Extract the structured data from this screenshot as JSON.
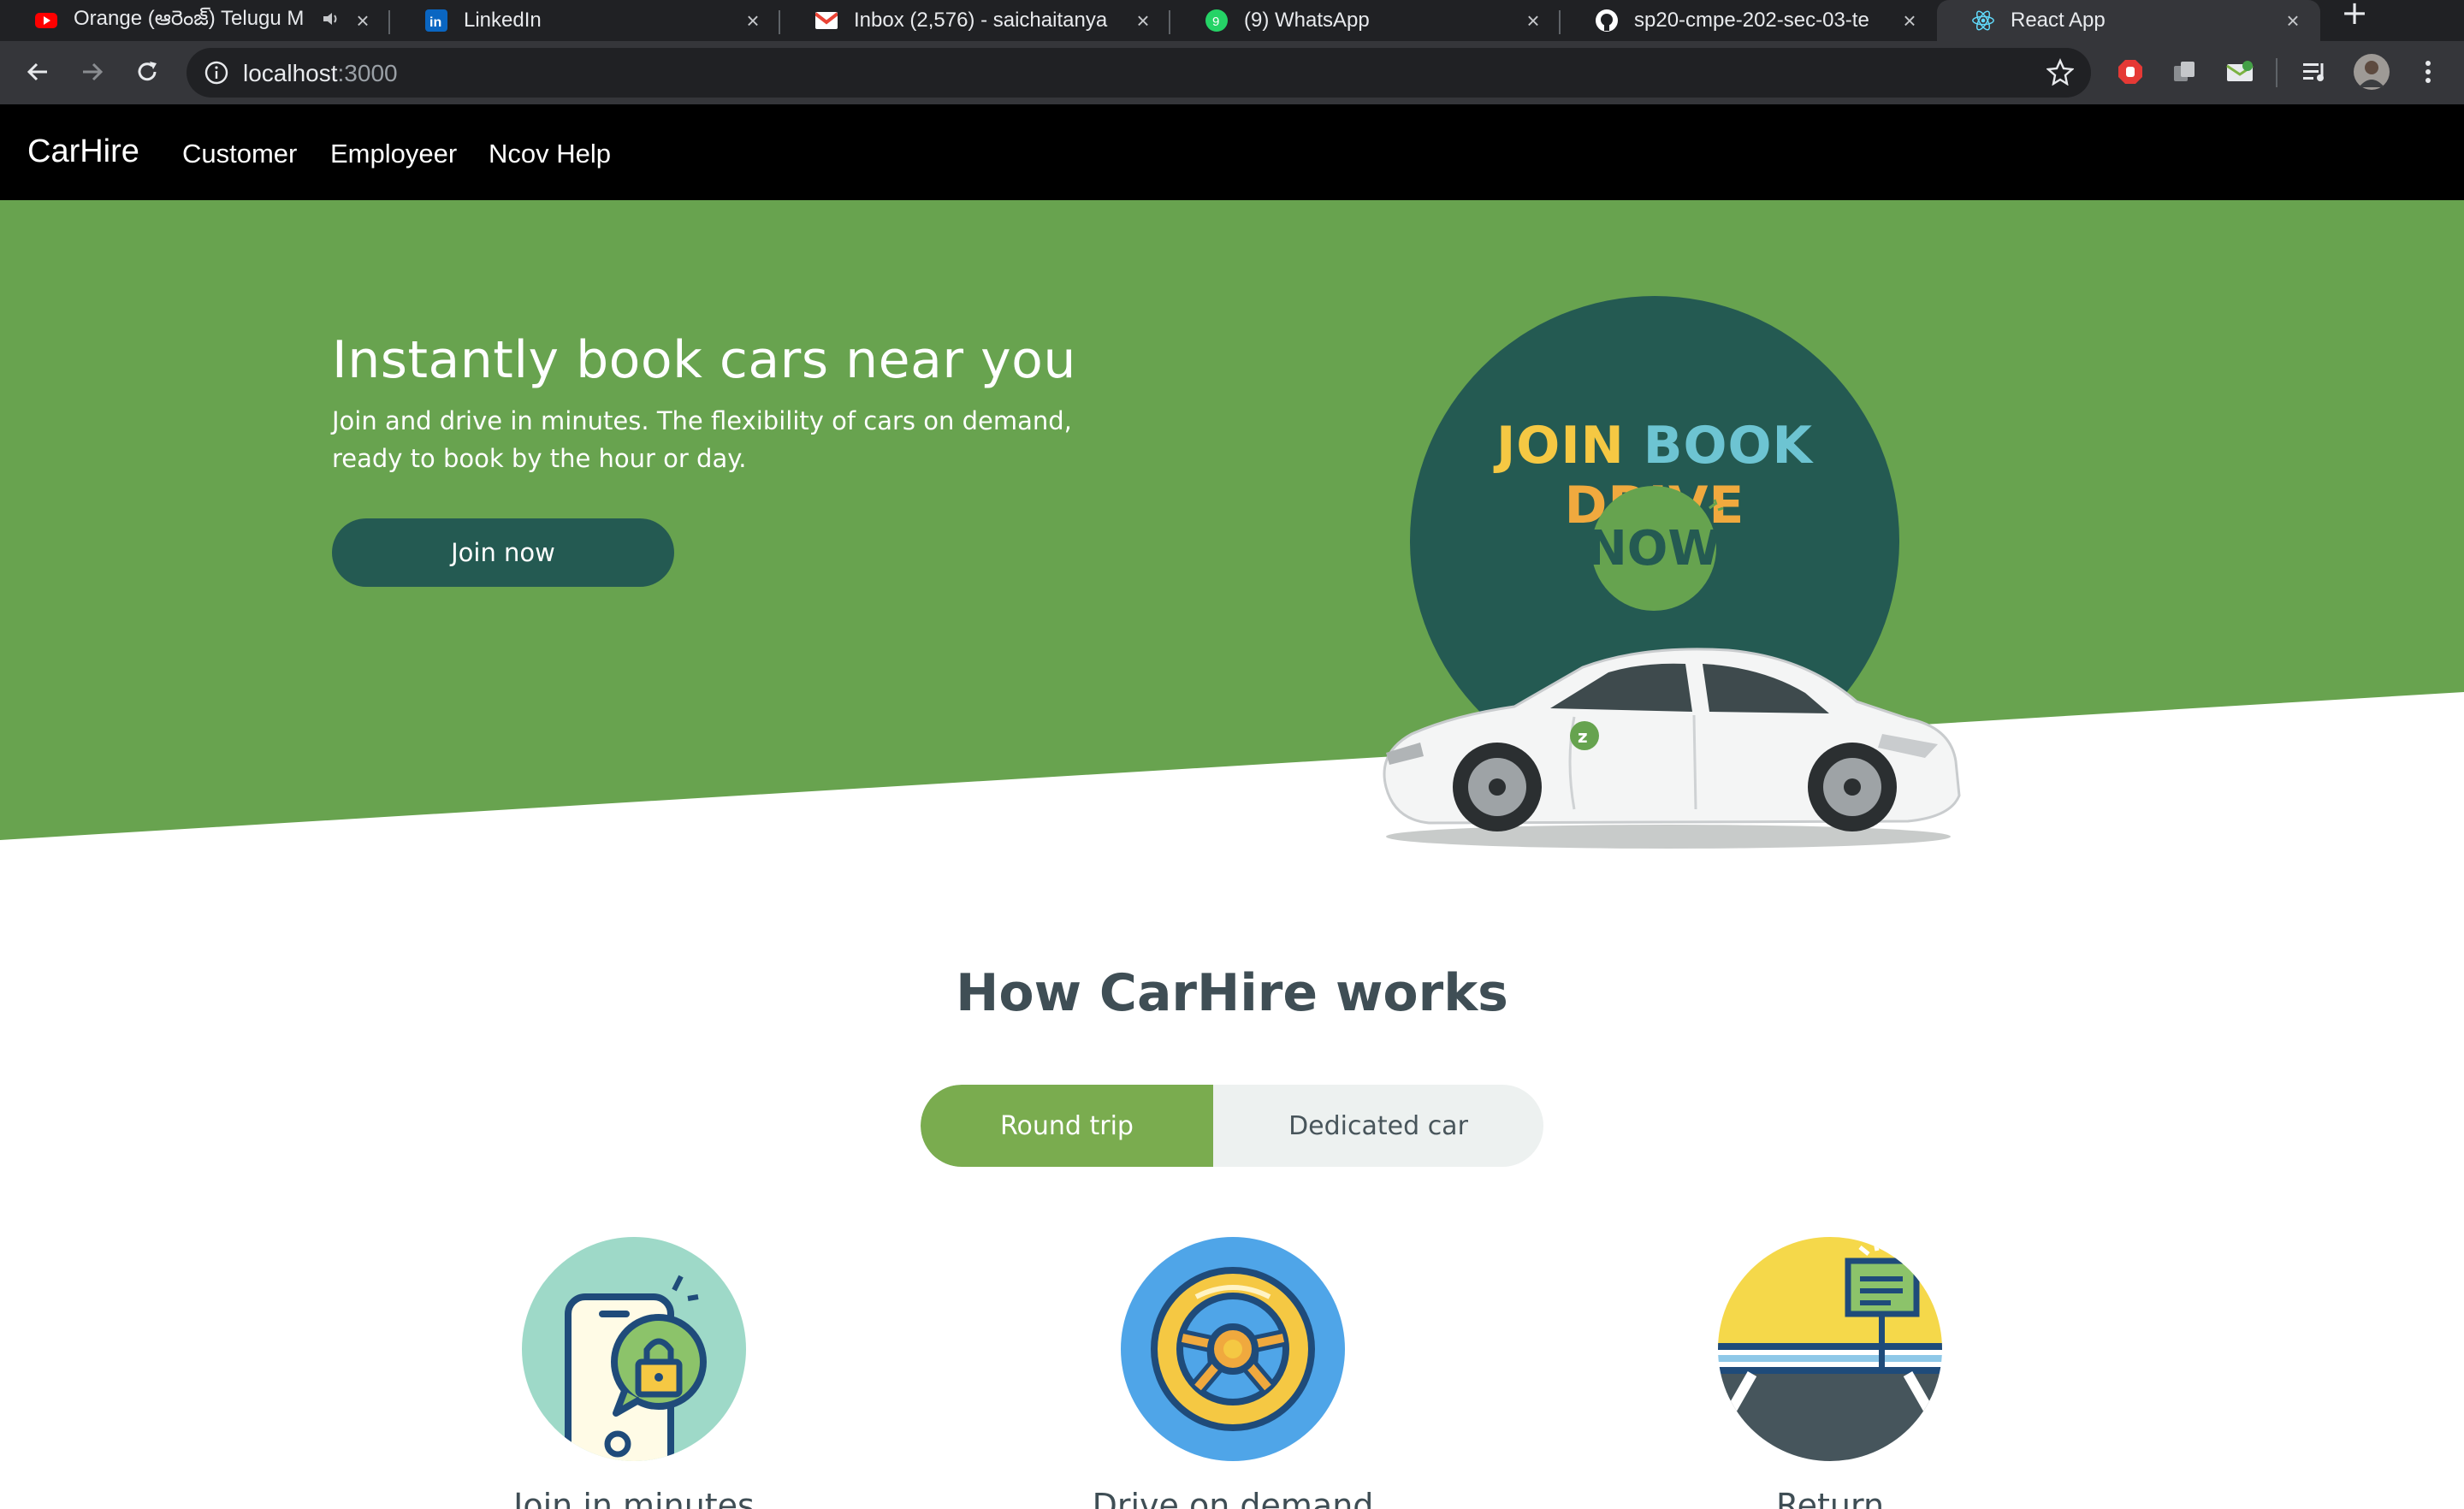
{
  "browser": {
    "tabs": [
      {
        "title": "Orange (ఆరెంజ్) Telugu M",
        "favicon": "youtube-icon",
        "audio": true
      },
      {
        "title": "LinkedIn",
        "favicon": "linkedin-icon"
      },
      {
        "title": "Inbox (2,576) - saichaitanya",
        "favicon": "gmail-icon"
      },
      {
        "title": "(9) WhatsApp",
        "favicon": "whatsapp-icon"
      },
      {
        "title": "sp20-cmpe-202-sec-03-te",
        "favicon": "github-icon"
      },
      {
        "title": "React App",
        "favicon": "react-icon",
        "active": true
      }
    ],
    "url_host": "localhost",
    "url_port": ":3000"
  },
  "nav": {
    "brand": "CarHire",
    "links": [
      "Customer",
      "Employeer",
      "Ncov Help"
    ]
  },
  "hero": {
    "title": "Instantly book cars near you",
    "subtitle_line1": "Join and drive in minutes. The flexibility of cars on demand,",
    "subtitle_line2": "ready to book by the hour or day.",
    "cta": "Join now",
    "promo": {
      "word1": "JOIN",
      "word2": "BOOK",
      "word3": "DRIVE",
      "now": "NOW"
    }
  },
  "how": {
    "title": "How CarHire works",
    "toggle": {
      "active": "Round trip",
      "inactive": "Dedicated car"
    },
    "steps": [
      {
        "label": "Join in minutes",
        "icon": "phone-lock-icon"
      },
      {
        "label": "Drive on demand",
        "icon": "steering-wheel-icon"
      },
      {
        "label": "Return",
        "icon": "parking-return-icon"
      }
    ]
  },
  "colors": {
    "hero_green": "#68a34f",
    "dark_teal": "#245a52",
    "toggle_green": "#7aac4f",
    "heading_gray": "#3f4e55"
  }
}
